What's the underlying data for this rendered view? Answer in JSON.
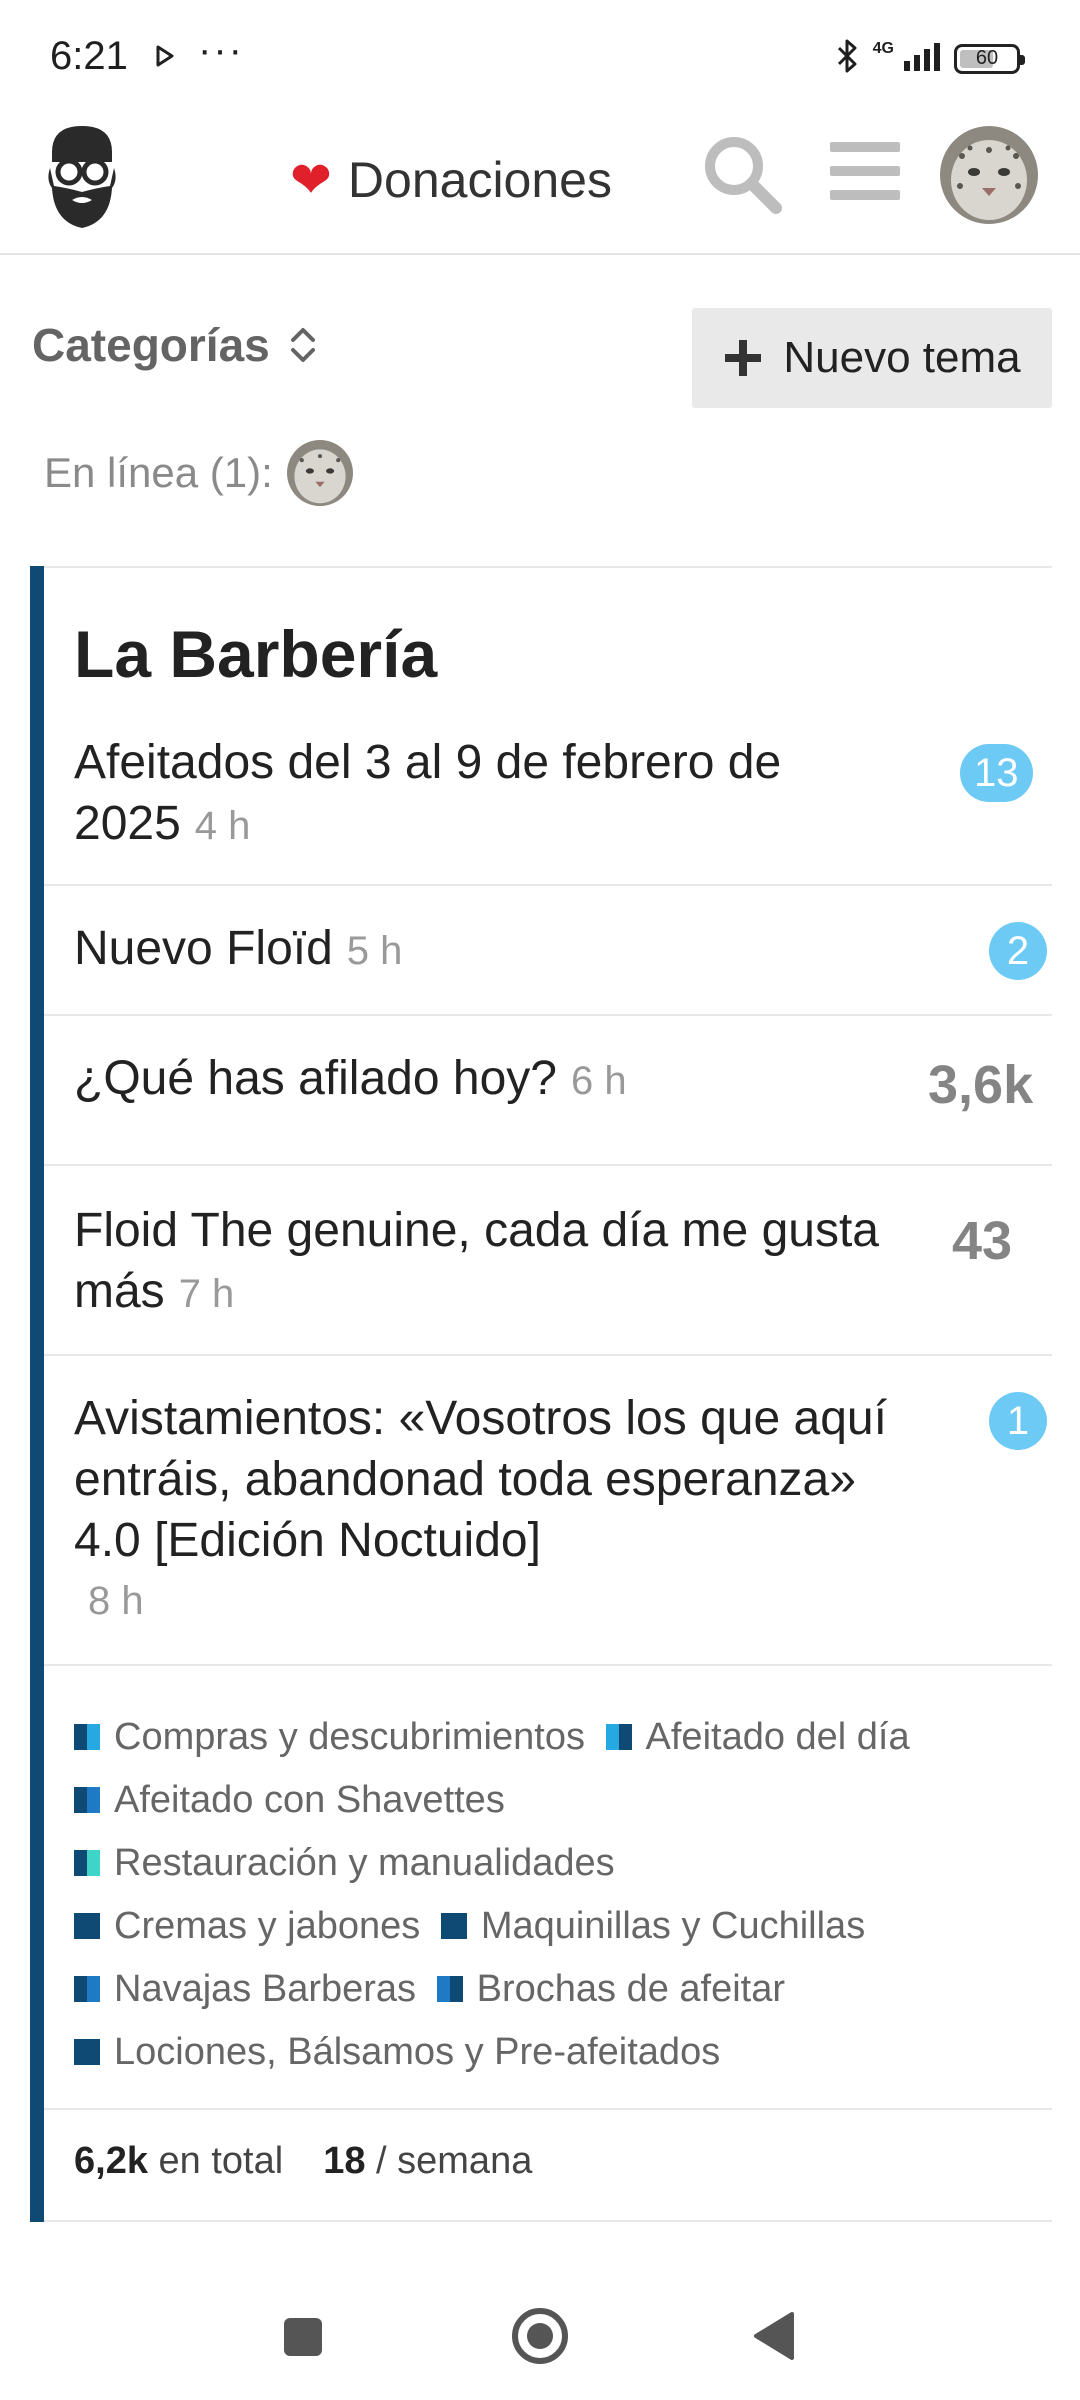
{
  "status_bar": {
    "time": "6:21",
    "dots": "···",
    "network": "4G",
    "battery": "60"
  },
  "header": {
    "donaciones_label": "Donaciones",
    "heart_icon": "heart"
  },
  "toolbar": {
    "categorias_label": "Categorías",
    "nuevo_tema_label": "Nuevo tema",
    "online_label": "En línea (1):"
  },
  "category": {
    "title": "La Barbería",
    "color": "#0e4a74",
    "topics": [
      {
        "title": "Afeitados del 3 al 9 de febrero de 2025",
        "age": "4 h",
        "badge": "13"
      },
      {
        "title": "Nuevo Floïd",
        "age": "5 h",
        "badge": "2"
      },
      {
        "title": "¿Qué has afilado hoy?",
        "age": "6 h",
        "count": "3,6k"
      },
      {
        "title": "Floid The genuine, cada día me gusta más",
        "age": "7 h",
        "count": "43"
      },
      {
        "title": "Avistamientos: «Vosotros los que aquí entráis, abandonad toda esperanza» 4.0 [Edición Noctuido]",
        "age": "8 h",
        "badge": "1"
      }
    ],
    "subcategories": [
      {
        "name": "Compras y descubrimientos",
        "color_left": "#0e4a74",
        "color_right": "#25a9e0"
      },
      {
        "name": "Afeitado del día",
        "color_left": "#25a9e0",
        "color_right": "#0e4a74"
      },
      {
        "name": "Afeitado con Shavettes",
        "color_left": "#0e4a74",
        "color_right": "#1e7ac4"
      },
      {
        "name": "Restauración y manualidades",
        "color_left": "#0e4a74",
        "color_right": "#3fd4c8"
      },
      {
        "name": "Cremas y jabones",
        "color_left": "#0e4a74",
        "color_right": "#0e4a74"
      },
      {
        "name": "Maquinillas y Cuchillas",
        "color_left": "#0e4a74",
        "color_right": "#0e4a74"
      },
      {
        "name": "Navajas Barberas",
        "color_left": "#0e4a74",
        "color_right": "#1e7ac4"
      },
      {
        "name": "Brochas de afeitar",
        "color_left": "#1e7ac4",
        "color_right": "#0e4a74"
      },
      {
        "name": "Lociones, Bálsamos y Pre-afeitados",
        "color_left": "#0e4a74",
        "color_right": "#0e4a74"
      }
    ],
    "stats": {
      "total_value": "6,2k",
      "total_label": "en total",
      "week_value": "18",
      "week_label": "/ semana"
    }
  },
  "colors": {
    "badge": "#6ccaf5",
    "category_bar": "#0e4a74",
    "button_bg": "#e9e9e9"
  }
}
